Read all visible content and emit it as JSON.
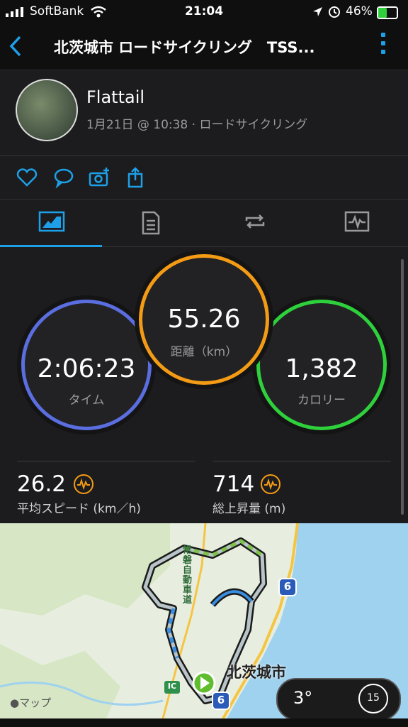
{
  "status": {
    "carrier": "SoftBank",
    "time": "21:04",
    "battery": "46%"
  },
  "header": {
    "title": "北茨城市 ロードサイクリング　TSS..."
  },
  "profile": {
    "name": "Flattail",
    "meta": "1月21日 @ 10:38 · ロードサイクリング"
  },
  "rings": {
    "time": {
      "value": "2:06:23",
      "label": "タイム"
    },
    "distance": {
      "value": "55.26",
      "label": "距離（km）"
    },
    "calories": {
      "value": "1,382",
      "label": "カロリー"
    }
  },
  "stats": {
    "speed": {
      "value": "26.2",
      "label": "平均スピード (km／h)"
    },
    "ascent": {
      "value": "714",
      "label": "総上昇量 (m)"
    }
  },
  "map": {
    "city": "北茨城市",
    "expressway": "常磐自動車道",
    "route_badge": "6",
    "ic_badge": "IC",
    "attribution": "マップ"
  },
  "weather": {
    "temp": "3°",
    "wind": "15"
  },
  "colors": {
    "accent": "#1ea0e8",
    "time_ring": "#5b6ee0",
    "distance_ring": "#f49b15",
    "calories_ring": "#2ed13b"
  }
}
